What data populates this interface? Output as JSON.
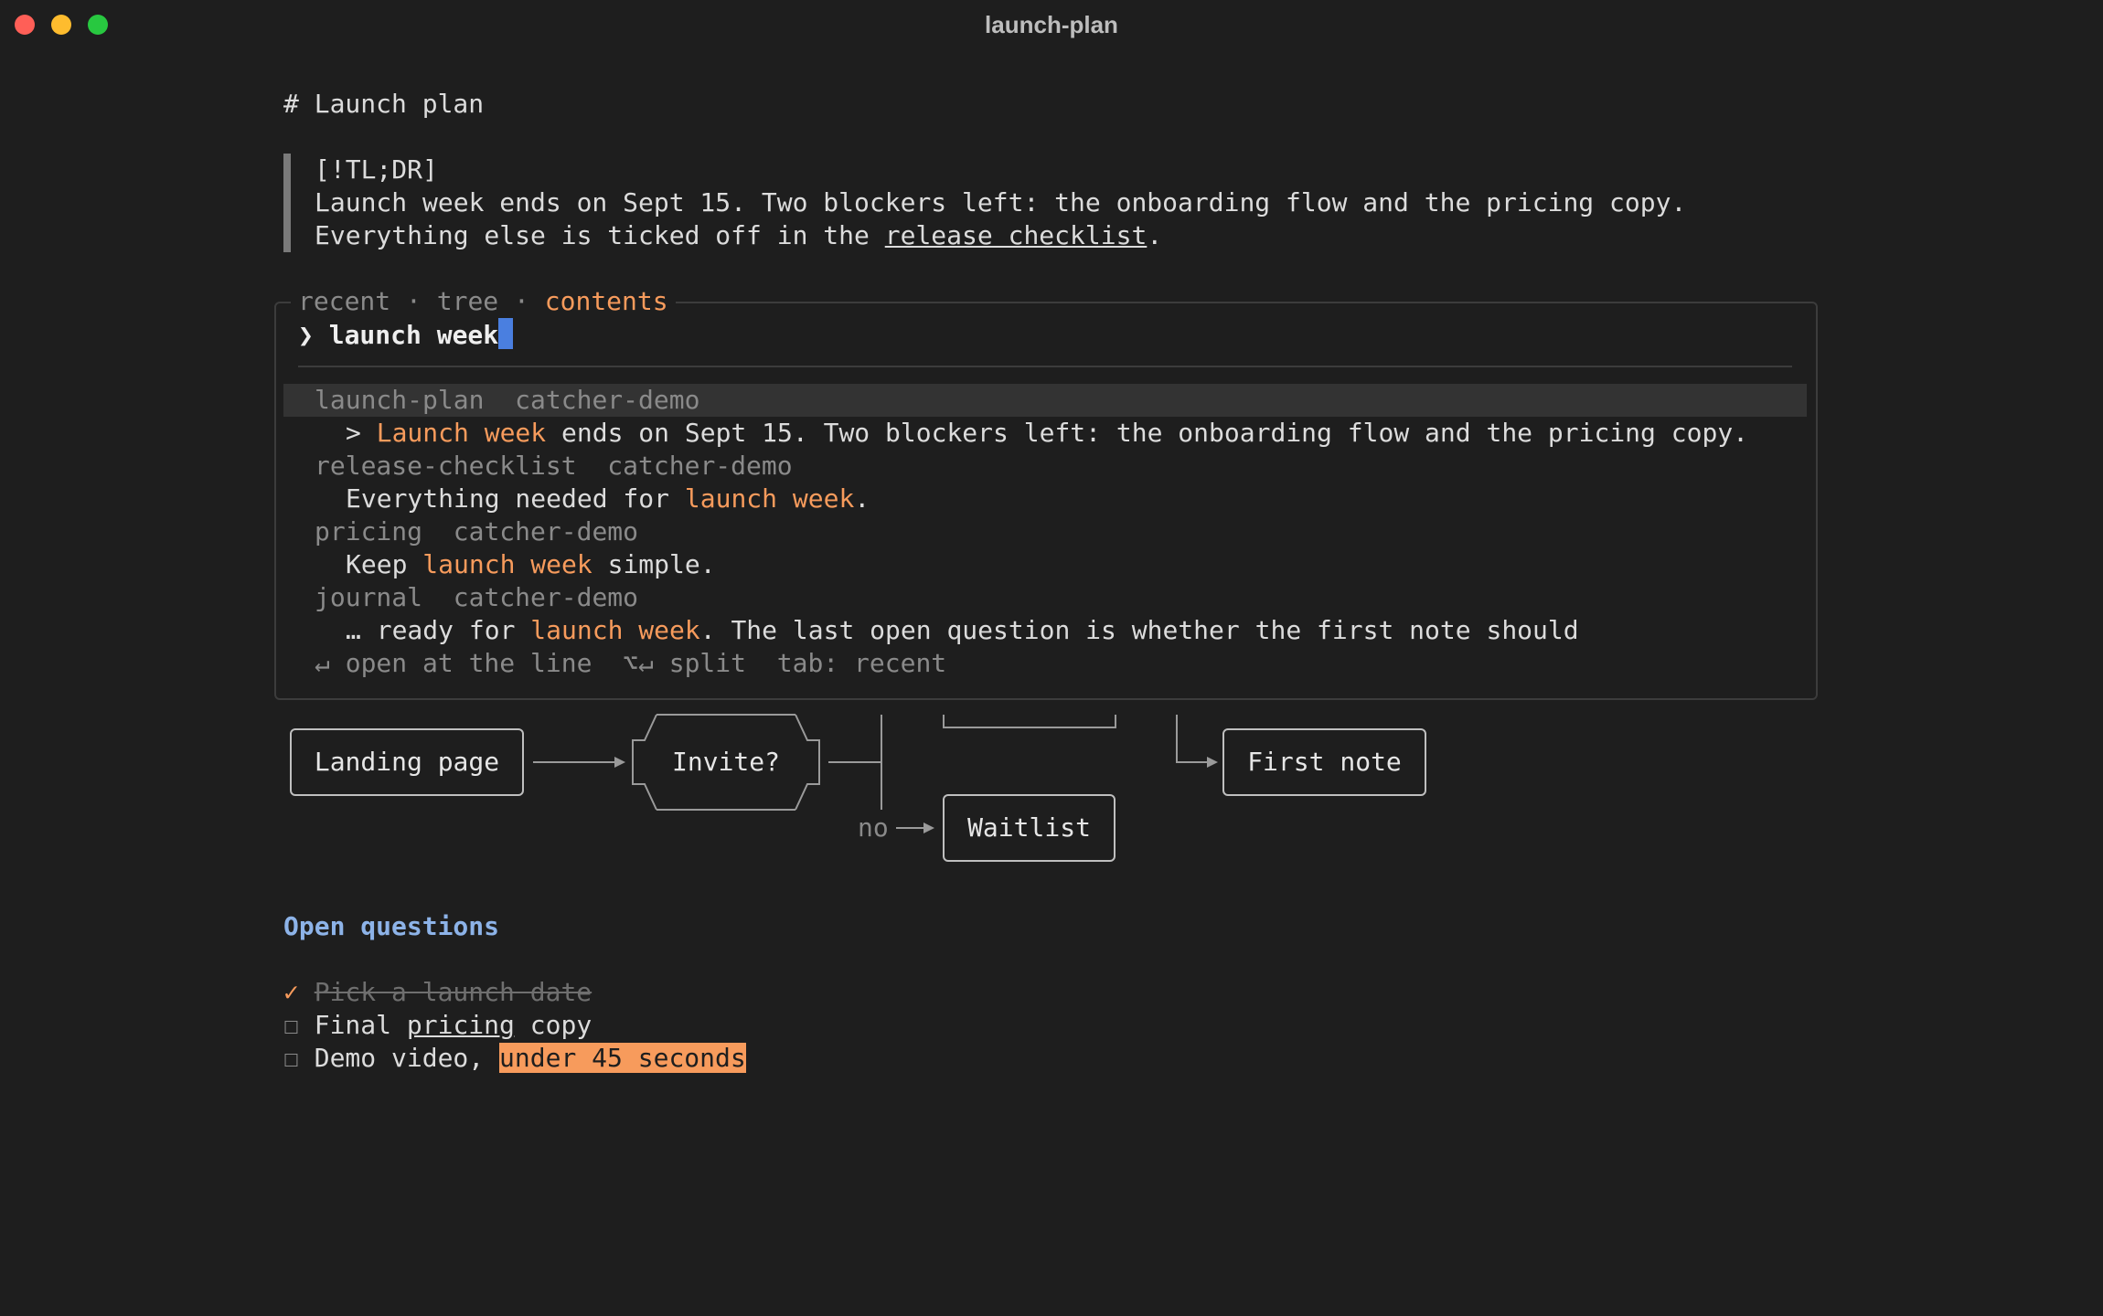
{
  "window": {
    "title": "launch-plan"
  },
  "doc": {
    "heading": "# Launch plan",
    "callout": {
      "tag": "[!TL;DR]",
      "line1": "Launch week ends on Sept 15. Two blockers left: the onboarding flow and the pricing copy.",
      "line2_pre": "Everything else is ticked off in the ",
      "line2_link": "release checklist",
      "line2_post": "."
    }
  },
  "search": {
    "tabs": {
      "recent": "recent",
      "sep": " · ",
      "tree": "tree",
      "contents": "contents"
    },
    "prompt": "❯ ",
    "query": "launch week",
    "results": [
      {
        "file": "launch-plan",
        "vault": "catcher-demo",
        "pre": "> ",
        "match": "Launch week",
        "post": " ends on Sept 15. Two blockers left: the onboarding flow and the pricing copy."
      },
      {
        "file": "release-checklist",
        "vault": "catcher-demo",
        "pre": "Everything needed for ",
        "match": "launch week",
        "post": "."
      },
      {
        "file": "pricing",
        "vault": "catcher-demo",
        "pre": "Keep ",
        "match": "launch week",
        "post": " simple."
      },
      {
        "file": "journal",
        "vault": "catcher-demo",
        "pre": "… ready for ",
        "match": "launch week",
        "post": ". The last open question is whether the first note should"
      }
    ],
    "footer": "↵ open at the line  ⌥↵ split  tab: recent"
  },
  "flow": {
    "landing": "Landing page",
    "invite": "Invite?",
    "no_label": "no",
    "waitlist": "Waitlist",
    "first_note": "First note"
  },
  "questions": {
    "heading": "Open questions",
    "items": [
      {
        "marker": "✓",
        "text": "Pick a launch date",
        "done": true
      },
      {
        "marker": "☐",
        "pre": "Final ",
        "link": "pricing",
        "post": " copy"
      },
      {
        "marker": "☐",
        "pre": "Demo video, ",
        "mark": "under 45 seconds"
      }
    ]
  },
  "colors": {
    "accent": "#f79b5c",
    "cursor": "#4a7fe0",
    "heading": "#8db3e8"
  }
}
